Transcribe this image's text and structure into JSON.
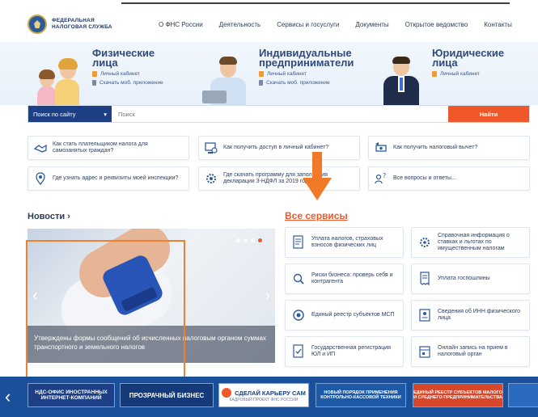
{
  "header": {
    "logo_line1": "ФЕДЕРАЛЬНАЯ",
    "logo_line2": "НАЛОГОВАЯ СЛУЖБА",
    "nav": [
      "О ФНС России",
      "Деятельность",
      "Сервисы и госуслуги",
      "Документы",
      "Открытое ведомство",
      "Контакты"
    ]
  },
  "hero": {
    "individuals": {
      "title1": "Физические",
      "title2": "лица",
      "cabinet": "Личный кабинет",
      "app": "Скачать моб. приложение"
    },
    "entrepreneurs": {
      "title1": "Индивидуальные",
      "title2": "предприниматели",
      "cabinet": "Личный кабинет",
      "app": "Скачать моб. приложение"
    },
    "legal": {
      "title1": "Юридические",
      "title2": "лица",
      "cabinet": "Личный кабинет"
    }
  },
  "search": {
    "select_label": "Поиск по сайту",
    "placeholder": "Поиск",
    "button": "Найти"
  },
  "quick_links": [
    {
      "text": "Как стать плательщиком налога для самозанятых граждан?",
      "icon": "handshake-icon"
    },
    {
      "text": "Как получить доступ в личный кабинет?",
      "icon": "computer-user-icon"
    },
    {
      "text": "Как получить налоговый вычет?",
      "icon": "money-return-icon"
    },
    {
      "text": "Где узнать адрес и реквизиты моей инспекции?",
      "icon": "location-pin-icon"
    },
    {
      "text": "Где скачать программу для заполнения декларации 3-НДФЛ за 2019 год?",
      "icon": "gear-download-icon"
    },
    {
      "text": "Все вопросы и ответы...",
      "icon": "question-people-icon"
    }
  ],
  "news": {
    "title": "Новости ›",
    "caption": "Утверждены формы сообщений об исчисленных налоговым органом суммах транспортного и земельного налогов"
  },
  "services": {
    "title": "Все сервисы",
    "items": [
      {
        "text": "Уплата налогов, страховых взносов физических лиц",
        "icon": "payment-doc-icon"
      },
      {
        "text": "Справочная информация о ставках и льготах по имущественным налогам",
        "icon": "info-gear-icon"
      },
      {
        "text": "Риски бизнеса: проверь себя и контрагента",
        "icon": "search-check-icon"
      },
      {
        "text": "Уплата госпошлины",
        "icon": "receipt-icon"
      },
      {
        "text": "Единый реестр субъектов МСП",
        "icon": "registry-icon"
      },
      {
        "text": "Сведения об ИНН физического лица",
        "icon": "id-card-icon"
      },
      {
        "text": "Государственная регистрация ЮЛ и ИП",
        "icon": "registration-icon"
      },
      {
        "text": "Онлайн запись на прием в налоговый орган",
        "icon": "appointment-icon"
      }
    ]
  },
  "banners": [
    {
      "text": "НДС-ОФИС ИНОСТРАННЫХ ИНТЕРНЕТ-КОМПАНИЙ",
      "color": "#1c3f85"
    },
    {
      "text": "ПРОЗРАЧНЫЙ БИЗНЕС",
      "color": "#143a7a"
    },
    {
      "text": "СДЕЛАЙ КАРЬЕРУ САМ",
      "sub": "КАДРОВЫЙ ПРОЕКТ ФНС РОССИИ",
      "color": "#ffffff"
    },
    {
      "text": "НОВЫЙ ПОРЯДОК ПРИМЕНЕНИЯ КОНТРОЛЬНО-КАССОВОЙ ТЕХНИКИ",
      "color": "#1c5aa8"
    },
    {
      "text": "ЕДИНЫЙ РЕЕСТР СУБЪЕКТОВ МАЛОГО И СРЕДНЕГО ПРЕДПРИНИМАТЕЛЬСТВА",
      "color": "#d9472b"
    }
  ],
  "colors": {
    "brand_blue": "#1c3f85",
    "accent_orange": "#f0582a",
    "annotation": "#f08030"
  }
}
